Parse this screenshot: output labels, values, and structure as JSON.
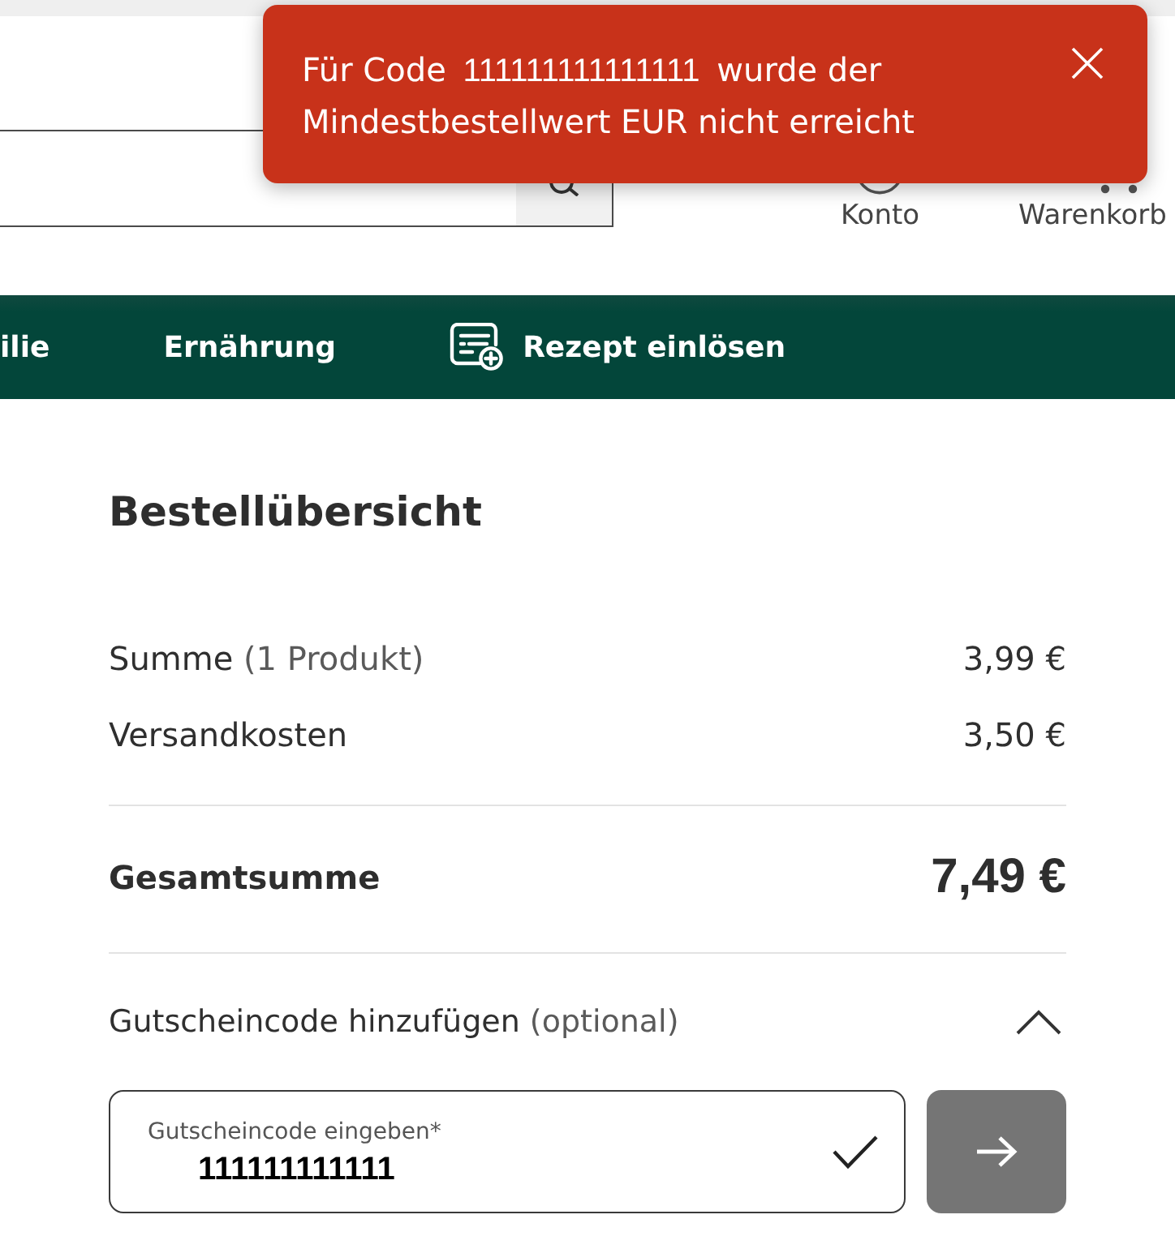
{
  "toast": {
    "text_before": "Für Code",
    "code": "111111111111111",
    "text_after": "wurde der Mindestbestellwert EUR nicht erreicht"
  },
  "header": {
    "account_label": "Konto",
    "cart_label": "Warenkorb"
  },
  "nav": {
    "items": [
      {
        "label": "ilie",
        "kind": "link"
      },
      {
        "label": "Ernährung",
        "kind": "link"
      },
      {
        "label": "Rezept einlösen",
        "kind": "prescription"
      }
    ]
  },
  "order_summary": {
    "title": "Bestellübersicht",
    "lines": [
      {
        "label": "Summe",
        "note": "(1 Produkt)",
        "amount": "3,99 €"
      },
      {
        "label": "Versandkosten",
        "amount": "3,50 €"
      }
    ],
    "total": {
      "label": "Gesamtsumme",
      "amount": "7,49 €"
    }
  },
  "voucher": {
    "title": "Gutscheincode hinzufügen",
    "note": "(optional)",
    "expanded": true,
    "field": {
      "label": "Gutscheincode eingeben*",
      "value": "111111111111",
      "valid": true
    }
  }
}
